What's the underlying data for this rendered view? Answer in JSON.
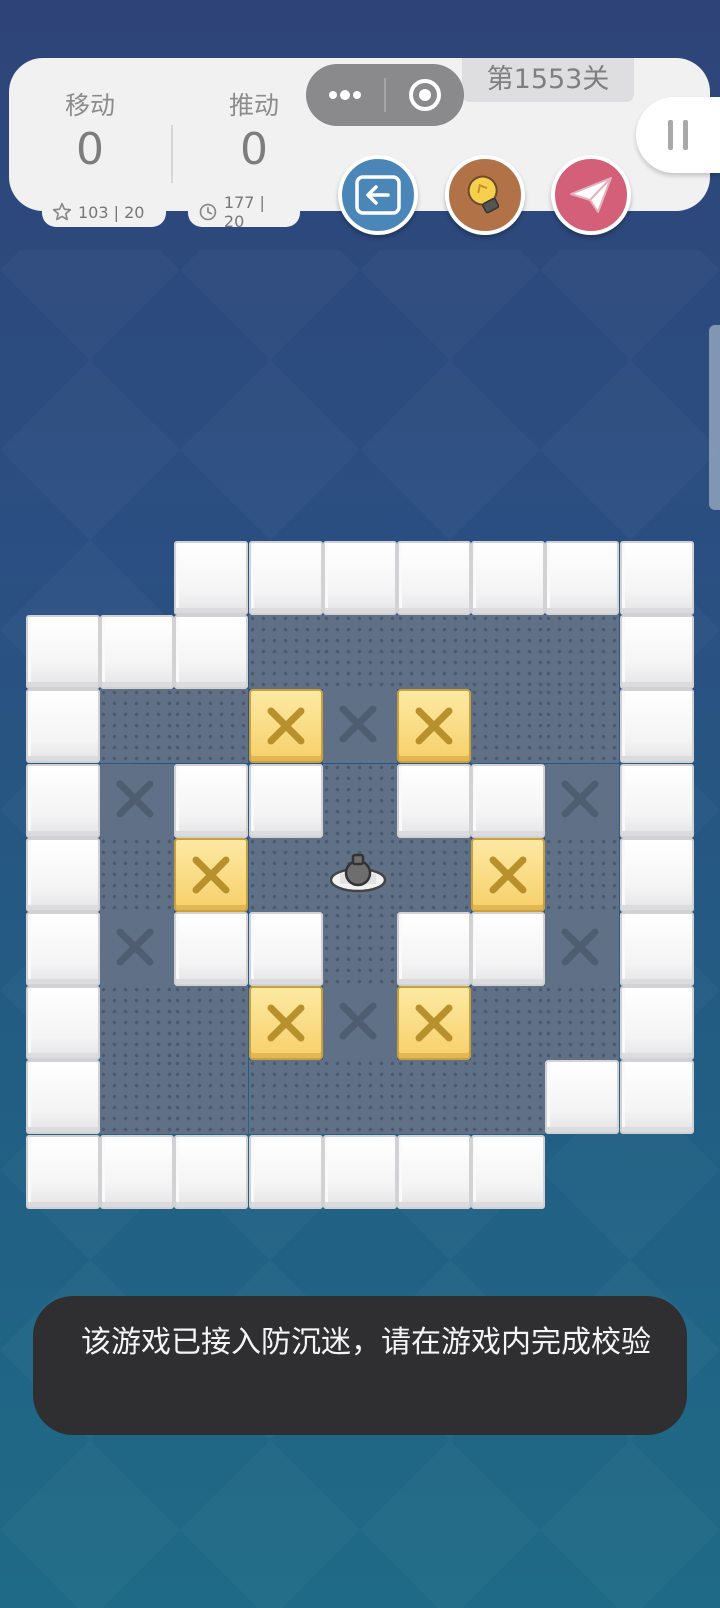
{
  "hud": {
    "moves_label": "移动",
    "moves_value": "0",
    "pushes_label": "推动",
    "pushes_value": "0",
    "moves_record": "103 | 20",
    "pushes_record": "177 | 20",
    "level": "第1553关"
  },
  "icons": {
    "more": "more-dots-icon",
    "target": "target-circle-icon",
    "undo": "undo-arrow-icon",
    "hint": "lightbulb-icon",
    "share": "paper-plane-icon",
    "pause": "pause-icon",
    "star": "star-icon",
    "clock": "clock-icon"
  },
  "colors": {
    "undo_button": "#4b86b8",
    "hint_button": "#b27248",
    "share_button": "#d35f78",
    "box": "#f7d06a",
    "floor": "#5f7087"
  },
  "board": {
    "rows": [
      "XXWWWWWWW",
      "WWW.....W",
      "W..B-B..W",
      "W-WW.WW-W",
      "W.B.@.B.W",
      "W-WW.WW-W",
      "W..B-B..W",
      "W......WW",
      "WWWWWWWXX"
    ],
    "legend": {
      "W": "wall",
      ".": "floor",
      "-": "goal",
      "B": "box on goal",
      "@": "player",
      "X": "empty"
    }
  },
  "toast": {
    "message": "该游戏已接入防沉迷，请在游戏内完成校验"
  }
}
